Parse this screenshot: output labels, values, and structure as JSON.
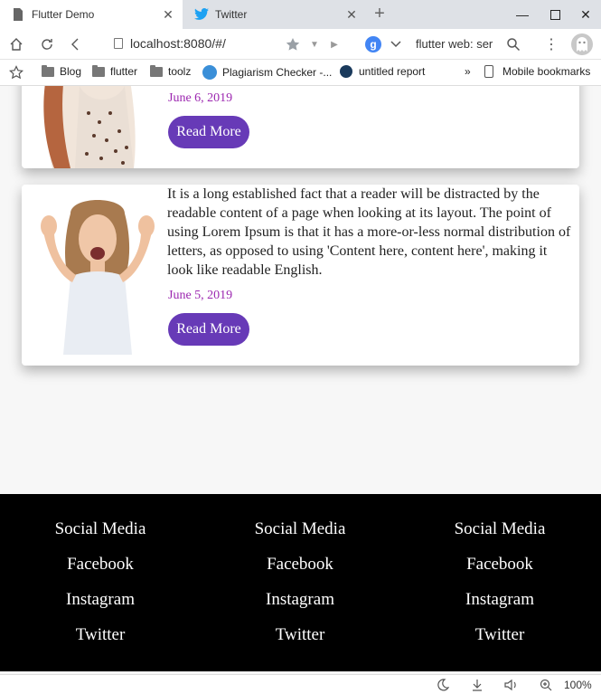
{
  "browser": {
    "tabs": [
      {
        "title": "Flutter Demo",
        "active": true
      },
      {
        "title": "Twitter",
        "active": false
      }
    ],
    "url": "localhost:8080/#/",
    "search_text": "flutter web: ser",
    "search_engine_letter": "g",
    "bookmarks": [
      {
        "label": "Blog",
        "icon": "folder-icon"
      },
      {
        "label": "flutter",
        "icon": "folder-icon"
      },
      {
        "label": "toolz",
        "icon": "folder-icon"
      },
      {
        "label": "Plagiarism Checker -...",
        "icon": "checker-icon"
      },
      {
        "label": "untitled report",
        "icon": "report-icon"
      }
    ],
    "bookmarks_overflow": "»",
    "mobile_bookmarks": "Mobile bookmarks",
    "zoom": "100%"
  },
  "cards": [
    {
      "date": "June 6, 2019",
      "read_more": "Read More"
    },
    {
      "text": "It is a long established fact that a reader will be distracted by the readable content of a page when looking at its layout. The point of using Lorem Ipsum is that it has a more-or-less normal distribution of letters, as opposed to using 'Content here, content here', making it look like readable English.",
      "date": "June 5, 2019",
      "read_more": "Read More"
    }
  ],
  "footer": {
    "columns": [
      {
        "heading": "Social Media",
        "links": [
          "Facebook",
          "Instagram",
          "Twitter"
        ]
      },
      {
        "heading": "Social Media",
        "links": [
          "Facebook",
          "Instagram",
          "Twitter"
        ]
      },
      {
        "heading": "Social Media",
        "links": [
          "Facebook",
          "Instagram",
          "Twitter"
        ]
      }
    ]
  },
  "colors": {
    "button": "#673ab7",
    "date": "#9c27b0",
    "footer_bg": "#000000"
  }
}
